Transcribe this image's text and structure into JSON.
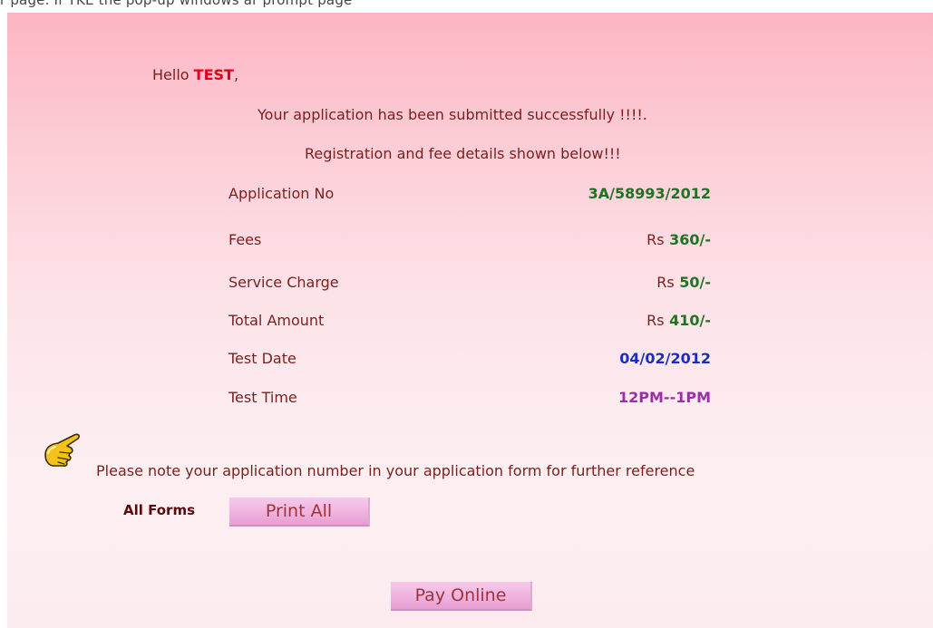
{
  "top_strip": {
    "text": "r page. If TKE the pop-up windows ar prompt page"
  },
  "greeting": {
    "prefix": "Hello",
    "name": "TEST",
    "suffix": ","
  },
  "messages": {
    "success": "Your application has been submitted successfully !!!!.",
    "details": "Registration and fee details shown below!!!",
    "note": "Please note your application number in your application form for further reference"
  },
  "details": {
    "currency_prefix": "Rs",
    "rows": [
      {
        "label": "Application No",
        "value": "3A/58993/2012",
        "color": "#207325"
      },
      {
        "label": "Fees",
        "value": "360/-",
        "color": "#207325"
      },
      {
        "label": "Service Charge",
        "value": "50/-",
        "color": "#207325"
      },
      {
        "label": "Total Amount",
        "value": "410/-",
        "color": "#207325"
      },
      {
        "label": "Test Date",
        "value": "04/02/2012",
        "color": "#1a2fbf"
      },
      {
        "label": "Test Time",
        "value": "12PM--1PM",
        "color": "#9a2fa6"
      }
    ]
  },
  "forms": {
    "label": "All Forms",
    "print_button": "Print All"
  },
  "payment": {
    "pay_button": "Pay Online"
  },
  "icons": {
    "note": "pointing-hand-icon"
  },
  "colors": {
    "panel_top": "#fbb5c2",
    "panel_bottom": "#fcecef",
    "label_text": "#7a1f1f",
    "name_red": "#e1001b",
    "button_pink": "#f0b3df"
  }
}
